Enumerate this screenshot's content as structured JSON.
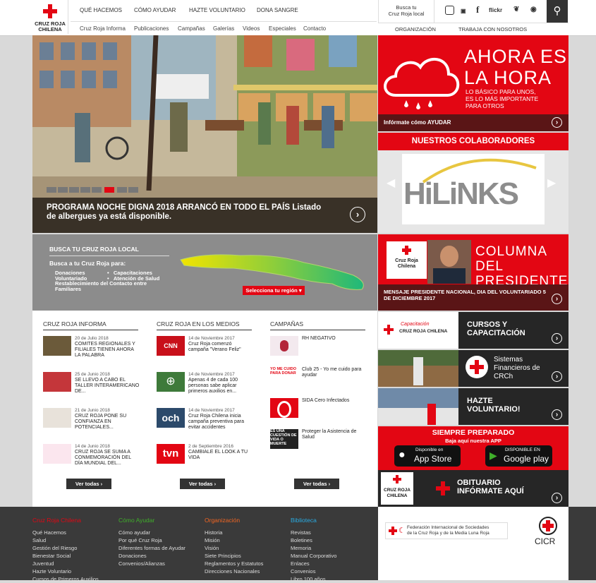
{
  "logo": {
    "line1": "CRUZ ROJA",
    "line2": "CHILENA"
  },
  "topnav": [
    "QUÉ HACEMOS",
    "CÓMO AYUDAR",
    "HAZTE VOLUNTARIO",
    "DONA SANGRE"
  ],
  "subnav": [
    "Cruz Roja Informa",
    "Publicaciones",
    "Campañas",
    "Galerías",
    "Videos",
    "Especiales",
    "Contacto"
  ],
  "local_search": {
    "line1": "Busca tu",
    "line2": "Cruz Roja local"
  },
  "social": [
    "instagram-icon",
    "youtube-icon",
    "facebook-icon",
    "flickr-icon",
    "twitter-icon",
    "rss-icon"
  ],
  "social_labels": {
    "flickr": "flickr",
    "facebook": "f"
  },
  "right_nav": [
    "ORGANIZACIÓN",
    "TRABAJA CON NOSOTROS"
  ],
  "hero": {
    "caption": "PROGRAMA NOCHE DIGNA 2018 ARRANCÓ EN TODO EL PAÍS Listado de albergues ya está disponible.",
    "slide_count": 8,
    "active_slide": 6
  },
  "ahora": {
    "line1": "AHORA ES",
    "line2": "LA HORA",
    "sub1": "LO BÁSICO PARA UNOS,",
    "sub2": "ES LO MÁS IMPORTANTE",
    "sub3": "PARA OTROS",
    "bar": "Infórmate cómo AYUDAR"
  },
  "colaboradores": {
    "title": "NUESTROS COLABORADORES",
    "logo_text": "HiLiNKS"
  },
  "presidente": {
    "line1": "COLUMNA DEL",
    "line2": "PRESIDENTE",
    "bar": "MENSAJE PRESIDENTE NACIONAL, DIA DEL VOLUNTARIADO 5 DE DICIEMBRE 2017",
    "logo1": "Cruz Roja",
    "logo2": "Chilena"
  },
  "tiles": [
    {
      "label": "CURSOS Y CAPACITACIÓN",
      "img_line1": "Capacitación",
      "img_line2": "CRUZ ROJA CHILENA"
    },
    {
      "label": "Sistemas Financieros de CRCh"
    },
    {
      "label": "HAZTE VOLUNTARIO!"
    }
  ],
  "siempre": {
    "title": "SIEMPRE PREPARADO",
    "sub": "Baja aquí nuestra APP",
    "appstore_top": "Disponible en",
    "appstore": "App Store",
    "gplay_top": "DISPONIBLE EN",
    "gplay": "Google play"
  },
  "obituario": {
    "line1": "OBITUARIO",
    "line2": "INFÓRMATE AQUÍ",
    "logo1": "CRUZ ROJA",
    "logo2": "CHILENA"
  },
  "busca": {
    "title": "BUSCA TU CRUZ ROJA LOCAL",
    "para": "Busca a tu Cruz Roja para:",
    "items": [
      "Donaciones",
      "Voluntariado",
      "Capacitaciones",
      "Atención de Salud",
      "Restablecimiento del Contacto entre Familiares"
    ],
    "select": "Selecciona tu región"
  },
  "news_cols": [
    {
      "title": "CRUZ ROJA INFORMA",
      "button": "Ver todas",
      "items": [
        {
          "date": "20 de Julio 2018",
          "text": "COMITES REGIONALES Y FILIALES TIENEN AHORA LA PALABRA"
        },
        {
          "date": "25 de Junio 2018",
          "text": "SE LLEVO A CABO EL TALLER INTERAMERICANO DE..."
        },
        {
          "date": "21 de Junio 2018",
          "text": "CRUZ ROJA PONE SU CONFIANZA EN POTENCIALES..."
        },
        {
          "date": "14 de Junio 2018",
          "text": "CRUZ ROJA SE SUMA A CONMEMORACIÓN DEL DÍA MUNDIAL DEL..."
        }
      ]
    },
    {
      "title": "CRUZ ROJA EN LOS MEDIOS",
      "button": "Ver todas",
      "items": [
        {
          "date": "14 de Noviembre 2017",
          "text": "Cruz Roja comenzó campaña \"Verano Feliz\""
        },
        {
          "date": "14 de Noviembre 2017",
          "text": "Apenas 4 de cada 100 personas sabe aplicar primeros auxilios en..."
        },
        {
          "date": "14 de Noviembre 2017",
          "text": "Cruz Roja Chilena inicia campaña preventiva para evitar accidentes"
        },
        {
          "date": "2 de Septiembre 2016",
          "text": "CAMBIALE EL LOOK A TU VIDA"
        }
      ]
    },
    {
      "title": "CAMPAÑAS",
      "button": "Ver todas",
      "items": [
        {
          "date": "",
          "text": "RH NEGATIVO"
        },
        {
          "date": "",
          "text": "Club 25 - Yo me cuido para ayudar"
        },
        {
          "date": "",
          "text": "SIDA Cero Infectados"
        },
        {
          "date": "",
          "text": "Proteger la Asistencia de Salud"
        }
      ]
    }
  ],
  "media_logos": [
    "CNN CHILE",
    "",
    "och",
    "tvn"
  ],
  "campaign_thumbs": [
    "",
    "YO ME CUIDO PARA DONAR",
    "",
    "ES UNA CUESTIÓN DE VIDA O MUERTE"
  ],
  "footer": [
    {
      "title": "Cruz Roja Chilena",
      "color": "#e30613",
      "items": [
        "Qué Hacemos",
        "Salud",
        "Gestión del Riesgo",
        "Bienestar Social",
        "Juventud",
        "Hazte Voluntario",
        "Cursos de Primeros Auxilios"
      ]
    },
    {
      "title": "Cómo Ayudar",
      "color": "#3fae2a",
      "items": [
        "Cómo ayudar",
        "Por qué Cruz Roja",
        "Diferentes formas de Ayudar",
        "Donaciones",
        "Convenios/Alianzas"
      ]
    },
    {
      "title": "Organización",
      "color": "#f26522",
      "items": [
        "Historia",
        "Misión",
        "Visión",
        "Siete Principios",
        "Reglamentos y Estatutos",
        "Direcciones Nacionales"
      ]
    },
    {
      "title": "Biblioteca",
      "color": "#29abe2",
      "items": [
        "Revistas",
        "Boletines",
        "Memoria",
        "Manual Corporativo",
        "Enlaces",
        "Convenios",
        "Libro 100 años"
      ]
    }
  ],
  "partners": {
    "ifrc1": "Federación Internacional de Sociedades",
    "ifrc2": "de la Cruz Roja y de la Media Luna Roja",
    "cicr": "CICR"
  },
  "colors": {
    "red": "#e30613",
    "dark_red": "#5a1516",
    "dark": "#262626"
  }
}
